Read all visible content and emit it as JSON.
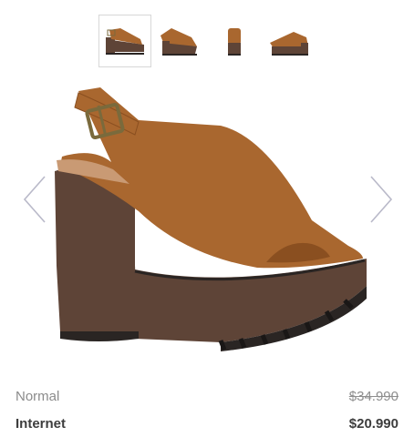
{
  "gallery": {
    "thumbnails": [
      {
        "label": "Thumbnail view 1",
        "selected": true
      },
      {
        "label": "Thumbnail view 2",
        "selected": false
      },
      {
        "label": "Thumbnail view 3",
        "selected": false
      },
      {
        "label": "Thumbnail view 4",
        "selected": false
      }
    ],
    "prev_icon": "chevron-left-icon",
    "next_icon": "chevron-right-icon"
  },
  "colors": {
    "suede": "#a9672f",
    "suede_dark": "#8a4f20",
    "platform": "#5e4437",
    "sole": "#2a2523",
    "buckle": "#7a6a3c",
    "arrow": "#b9b9c9"
  },
  "prices": {
    "normal_label": "Normal",
    "normal_value": "$34.990",
    "internet_label": "Internet",
    "internet_value": "$20.990"
  }
}
